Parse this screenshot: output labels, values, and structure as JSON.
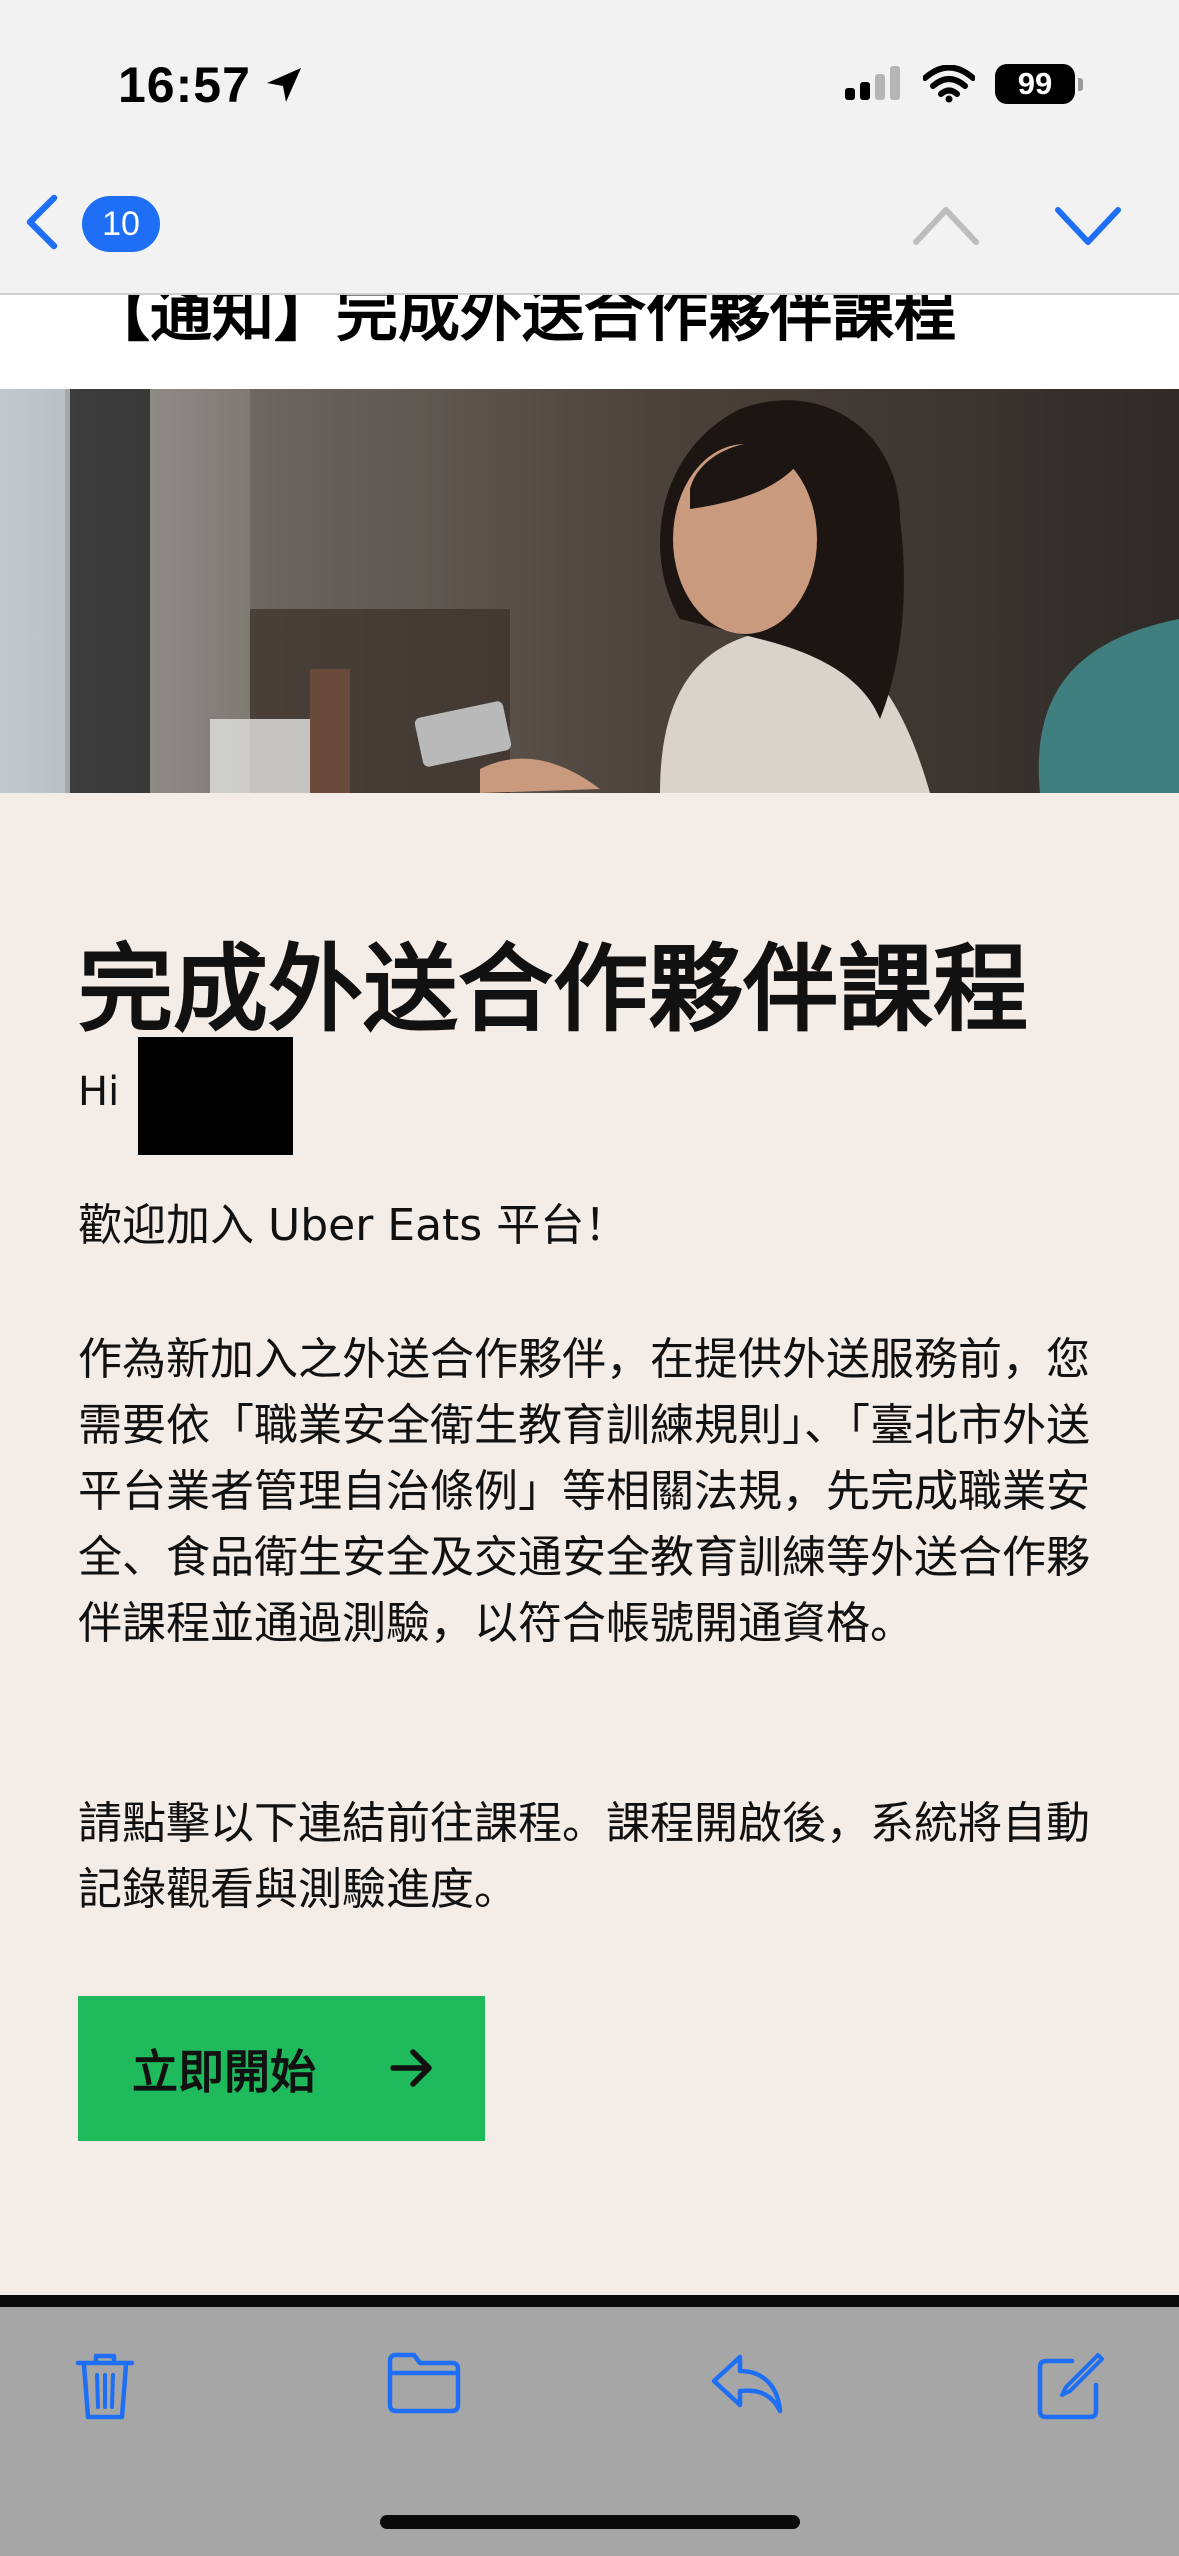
{
  "status_bar": {
    "time": "16:57",
    "battery": "99",
    "icons": [
      "location-arrow-icon",
      "cellular-signal-icon",
      "wifi-icon",
      "battery-icon"
    ]
  },
  "nav": {
    "unread_count": "10",
    "icons": [
      "chevron-left-icon",
      "chevron-up-icon",
      "chevron-down-icon"
    ],
    "accent_color": "#1e6ff5"
  },
  "email": {
    "subject": "【通知】完成外送合作夥伴課程",
    "headline": "完成外送合作夥伴課程",
    "greeting": "Hi",
    "welcome": "歡迎加入 Uber Eats 平台！",
    "body_paragraph": "作為新加入之外送合作夥伴，在提供外送服務前，您需要依「職業安全衛生教育訓練規則」、「臺北市外送平台業者管理自治條例」等相關法規，先完成職業安全、食品衛生安全及交通安全教育訓練等外送合作夥伴課程並通過測驗，以符合帳號開通資格。",
    "instruction_paragraph": "請點擊以下連結前往課程。課程開啟後，系統將自動記錄觀看與測驗進度。",
    "cta_label": "立即開始",
    "cta_color": "#1fba5c",
    "background_color": "#f3ece7"
  },
  "toolbar": {
    "icons": [
      "trash-icon",
      "folder-icon",
      "reply-icon",
      "compose-icon"
    ]
  }
}
